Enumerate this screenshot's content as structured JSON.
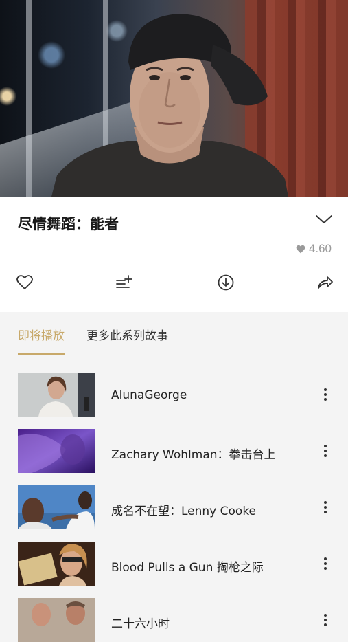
{
  "hero": {
    "image": "video-still-man-in-backwards-cap"
  },
  "episode": {
    "title": "尽情舞蹈：能者",
    "rating": "4.60",
    "icons": {
      "collapse": "chevron-down-icon",
      "rating": "heart-icon"
    }
  },
  "actions": [
    {
      "name": "like",
      "icon": "heart-outline-icon"
    },
    {
      "name": "add-to-playlist",
      "icon": "playlist-add-icon"
    },
    {
      "name": "download",
      "icon": "download-icon"
    },
    {
      "name": "share",
      "icon": "share-icon"
    }
  ],
  "tabs": [
    {
      "label": "即将播放",
      "active": true
    },
    {
      "label": "更多此系列故事",
      "active": false
    }
  ],
  "playlist": [
    {
      "title": "AlunaGeorge",
      "thumb": "woman-at-station"
    },
    {
      "title": "Zachary Wohlman：拳击台上",
      "thumb": "purple-close-up"
    },
    {
      "title": "成名不在望：Lenny Cooke",
      "thumb": "two-men-blue-sky"
    },
    {
      "title": "Blood Pulls a Gun 掏枪之际",
      "thumb": "woman-with-sunglasses"
    },
    {
      "title": "二十六小时",
      "thumb": "two-men-outdoors"
    }
  ],
  "colors": {
    "accent": "#c8a96a",
    "background": "#f4f4f4",
    "panel": "#ffffff"
  }
}
